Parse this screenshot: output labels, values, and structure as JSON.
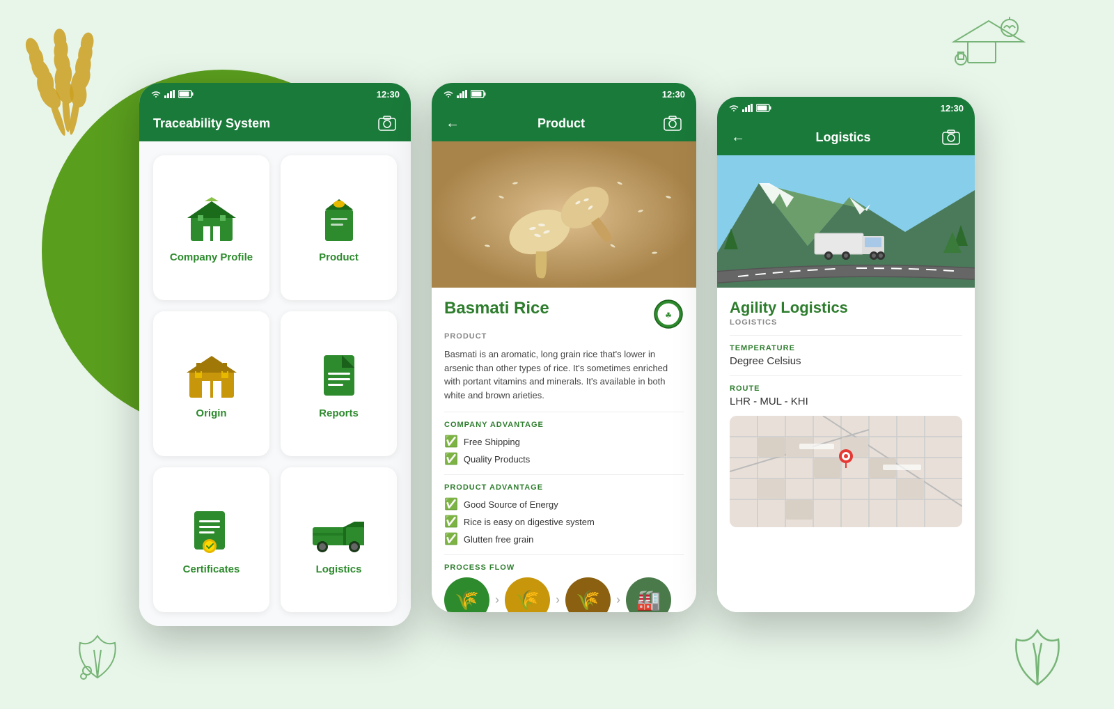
{
  "background": {
    "circle_color": "#5a9e1e"
  },
  "phone1": {
    "status_time": "12:30",
    "header_title": "Traceability System",
    "menu_items": [
      {
        "id": "company-profile",
        "label": "Company Profile",
        "icon": "barn"
      },
      {
        "id": "product",
        "label": "Product",
        "icon": "grain-bag"
      },
      {
        "id": "origin",
        "label": "Origin",
        "icon": "barn-field"
      },
      {
        "id": "reports",
        "label": "Reports",
        "icon": "document"
      },
      {
        "id": "certificates",
        "label": "Certificates",
        "icon": "certificate"
      },
      {
        "id": "logistics",
        "label": "Logistics",
        "icon": "truck"
      }
    ]
  },
  "phone2": {
    "status_time": "12:30",
    "header_title": "Product",
    "product_name": "Basmati Rice",
    "product_type": "PRODUCT",
    "description": "Basmati is an aromatic, long grain rice that's lower in arsenic than other types of rice. It's sometimes enriched with portant vitamins and minerals. It's available in both white and brown arieties.",
    "company_advantage_label": "COMPANY ADVANTAGE",
    "company_advantages": [
      "Free Shipping",
      "Quality Products"
    ],
    "product_advantage_label": "PRODUCT ADVANTAGE",
    "product_advantages": [
      "Good Source of Energy",
      "Rice is easy on digestive system",
      "Glutten free grain"
    ],
    "process_flow_label": "PROCESS FLOW"
  },
  "phone3": {
    "status_time": "12:30",
    "header_title": "Logistics",
    "company_name": "Agility Logistics",
    "company_type": "LOGISTICS",
    "temperature_label": "TEMPERATURE",
    "temperature_value": "Degree Celsius",
    "route_label": "ROUTE",
    "route_value": "LHR - MUL - KHI"
  }
}
